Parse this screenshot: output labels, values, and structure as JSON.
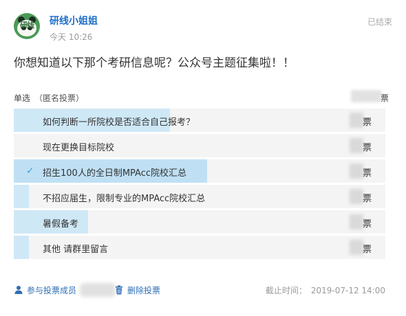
{
  "header": {
    "author": "研线小姐姐",
    "avatar_text": "研线",
    "time": "今天 10:26",
    "status": "已结束"
  },
  "question": "你想知道以下那个考研信息呢？公众号主题征集啦！！",
  "meta": {
    "type": "单选",
    "anonymous": "（匿名投票）",
    "header_edge": "票"
  },
  "options": [
    {
      "label": "如何判断一所院校是否适合自己报考？",
      "votes_suffix": "票",
      "selected": false,
      "share": 0.42
    },
    {
      "label": "现在更换目标院校",
      "votes_suffix": "票",
      "selected": false,
      "share": 0.0
    },
    {
      "label": "招生100人的全日制MPAcc院校汇总",
      "votes_suffix": "票",
      "selected": true,
      "share": 0.52
    },
    {
      "label": "不招应届生，限制专业的MPAcc院校汇总",
      "votes_suffix": "票",
      "selected": false,
      "share": 0.04
    },
    {
      "label": "暑假备考",
      "votes_suffix": "票",
      "selected": false,
      "share": 0.2
    },
    {
      "label": "其他  请群里留言",
      "votes_suffix": "票",
      "selected": false,
      "share": 0.04
    }
  ],
  "footer": {
    "join_label": "参与投票成员",
    "delete_label": "删除投票",
    "deadline_label": "截止时间：",
    "deadline_value": "2019-07-12 14:00"
  },
  "colors": {
    "link": "#2f6fb5",
    "author": "#1e6ec8",
    "bar_fill": "#cfe8f6",
    "row_bg": "#f4f4f4"
  },
  "icons": {
    "join": "person-icon",
    "delete": "trash-icon",
    "selected": "checkmark-icon"
  }
}
